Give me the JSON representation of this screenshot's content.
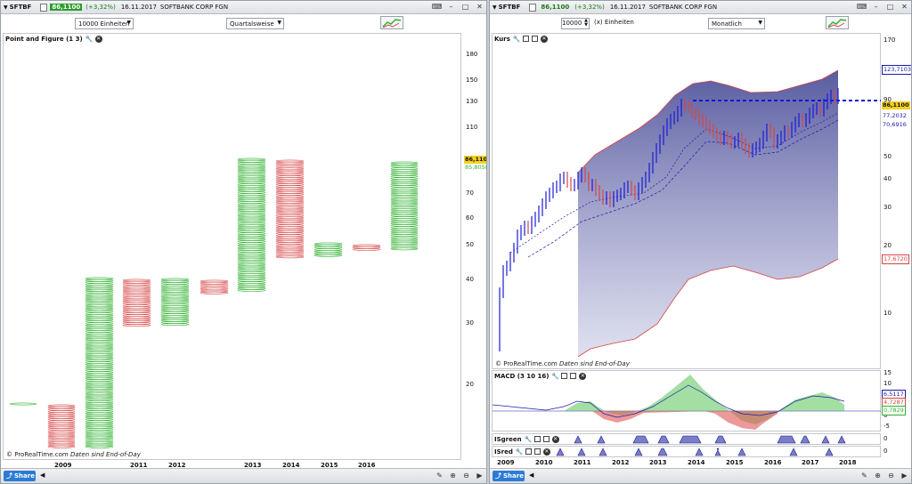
{
  "left": {
    "titlebar": {
      "symbol": "SFTBF",
      "price": "86,1100",
      "change": "(+3,32%)",
      "date": "16.11.2017",
      "name": "SOFTBANK CORP FGN"
    },
    "units_select": "10000 Einheiten",
    "period_select": "Quartalsweise",
    "panel_title": "Point and Figure (1 3)",
    "watermark": {
      "brand": "© ProRealTime.com",
      "note": "Daten sind End-of-Day"
    },
    "y_ticks": [
      "180",
      "150",
      "130",
      "110",
      "70",
      "60",
      "50",
      "40",
      "30",
      "20"
    ],
    "price_tags": {
      "last": "86,1100",
      "secondary": "85,8058"
    },
    "x_ticks": [
      "2009",
      "2011",
      "2012",
      "2013",
      "2014",
      "2015",
      "2016"
    ],
    "share_label": "Share",
    "colors": {
      "up": "#2fb02f",
      "down": "#d64545"
    }
  },
  "right": {
    "titlebar": {
      "symbol": "SFTBF",
      "price": "86,1100",
      "change": "(+3,32%)",
      "date": "16.11.2017",
      "name": "SOFTBANK CORP FGN"
    },
    "quantity": "10000",
    "quantity_label": "(x) Einheiten",
    "period_select": "Monatlich",
    "price_panel_title": "Kurs",
    "macd_title": "MACD (3 10 16)",
    "isgreen_title": "ISgreen",
    "isred_title": "ISred",
    "watermark": {
      "brand": "© ProRealTime.com",
      "note": "Daten sind End-of-Day"
    },
    "y_ticks": [
      "170",
      "90",
      "50",
      "40",
      "30",
      "20",
      "10"
    ],
    "price_tags": {
      "upper": "123,7103",
      "last": "86,1100",
      "mid": "77,2032",
      "low": "70,6916",
      "bottom": "17,6720"
    },
    "macd_ticks": [
      "15",
      "10",
      "5",
      "0",
      "-5"
    ],
    "macd_tags": {
      "a": "6,5117",
      "b": "4,7287",
      "c": "0,7829"
    },
    "isgreen_tick": "0",
    "isred_tick": "0",
    "x_ticks": [
      "2009",
      "2010",
      "2011",
      "2012",
      "2013",
      "2014",
      "2015",
      "2016",
      "2017",
      "2018"
    ],
    "share_label": "Share"
  }
}
